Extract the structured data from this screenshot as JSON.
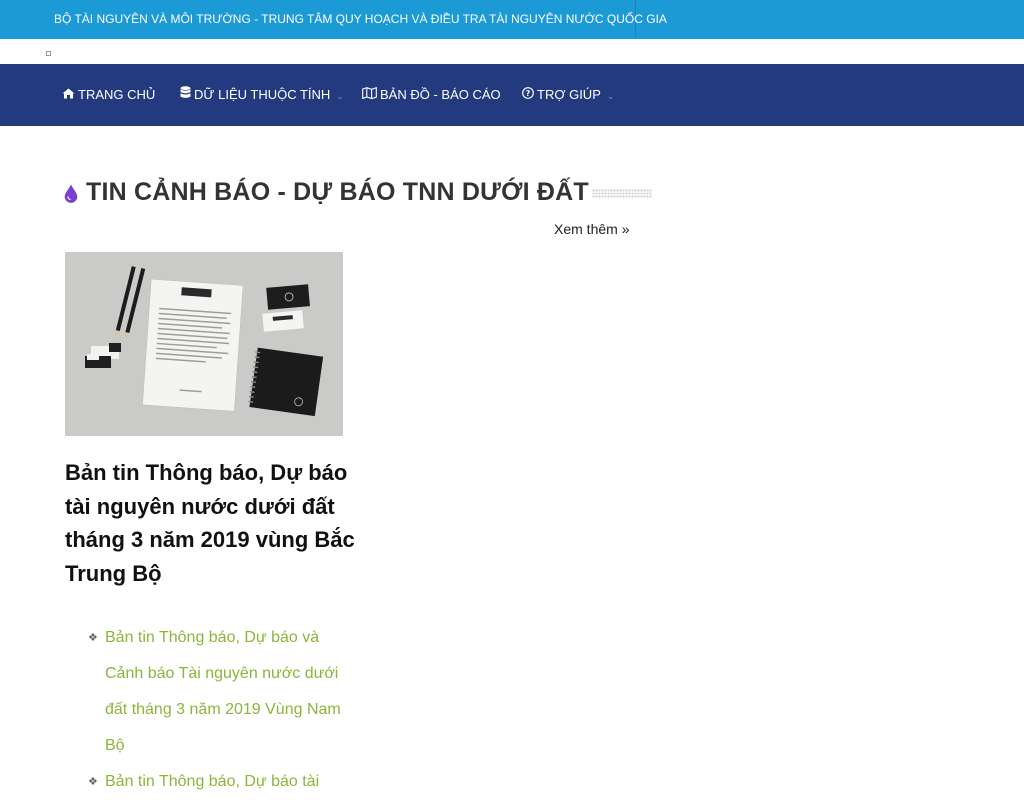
{
  "topbar": {
    "org_text": "BỘ TÀI NGUYÊN VÀ MÔI TRƯỜNG - TRUNG TÂM QUY HOẠCH VÀ ĐIỀU TRA TÀI NGUYÊN NƯỚC QUỐC GIA"
  },
  "nav": {
    "items": [
      {
        "label": "TRANG CHỦ",
        "icon": "home-icon"
      },
      {
        "label": "DỮ LIỆU THUỘC TÍNH",
        "icon": "database-icon",
        "has_dropdown": true
      },
      {
        "label": "BẢN ĐỒ - BÁO CÁO",
        "icon": "map-icon"
      },
      {
        "label": "TRỢ GIÚP",
        "icon": "question-circle-icon",
        "has_dropdown": true
      }
    ]
  },
  "section": {
    "title": "TIN CẢNH BÁO - DỰ BÁO TNN DƯỚI ĐẤT",
    "more_label": "Xem thêm »"
  },
  "featured": {
    "headline": "Bản tin Thông báo, Dự báo tài nguyên nước dưới đất tháng 3 năm 2019 vùng Bắc Trung Bộ"
  },
  "related": [
    {
      "title": "Bản tin Thông báo, Dự báo và Cảnh báo Tài nguyên nước dưới đất tháng 3 năm 2019 Vùng Nam Bộ"
    },
    {
      "title": "Bản tin Thông báo, Dự báo tài"
    }
  ],
  "colors": {
    "topbar_bg": "#1b9ad6",
    "navbar_bg": "#233a7e",
    "link_green": "#8bb53a",
    "accent_purple": "#7a3fd1"
  }
}
